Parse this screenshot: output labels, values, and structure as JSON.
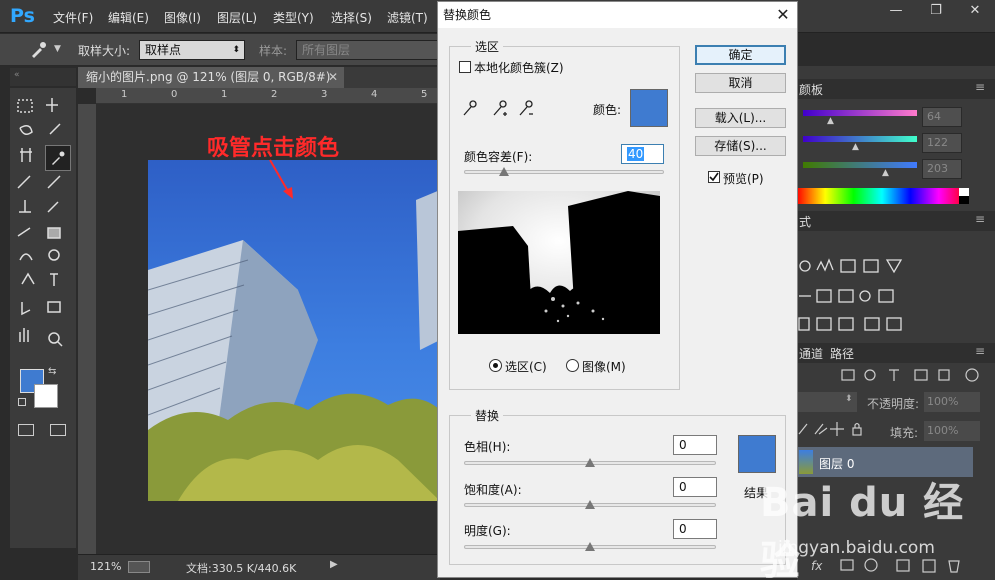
{
  "app": {
    "logo": "Ps",
    "menus": [
      "文件(F)",
      "编辑(E)",
      "图像(I)",
      "图层(L)",
      "类型(Y)",
      "选择(S)",
      "滤镜(T)"
    ]
  },
  "options": {
    "sample_size_label": "取样大小:",
    "sample_size_value": "取样点",
    "sample_label": "样本:",
    "sample_value": "所有图层"
  },
  "document": {
    "tab_title": "缩小的图片.png @ 121% (图层 0, RGB/8#)",
    "ruler_marks": [
      "1",
      "0",
      "1",
      "2",
      "3",
      "4",
      "5"
    ],
    "annotation": "吸管点击颜色",
    "zoom": "121%",
    "doc_info": "文档:330.5 K/440.6K"
  },
  "dialog": {
    "title": "替换颜色",
    "selection_group": "选区",
    "localized_label": "本地化颜色簇(Z)",
    "color_label": "颜色:",
    "fuzziness_label": "颜色容差(F):",
    "fuzziness_value": "40",
    "fuzziness_level": 0.2,
    "radio_selection": "选区(C)",
    "radio_image": "图像(M)",
    "ok": "确定",
    "cancel": "取消",
    "load": "载入(L)...",
    "save": "存储(S)...",
    "preview": "预览(P)",
    "replace_group": "替换",
    "hue_label": "色相(H):",
    "hue_value": "0",
    "saturation_label": "饱和度(A):",
    "saturation_value": "0",
    "lightness_label": "明度(G):",
    "lightness_value": "0",
    "result_label": "结果",
    "swatch_color": "#3f7bd0"
  },
  "panels": {
    "color_tab": "颜板",
    "r_value": "64",
    "g_value": "122",
    "b_value": "203",
    "styles_tab": "式",
    "channels_tab": "通道",
    "paths_tab": "路径",
    "opacity_label": "不透明度:",
    "opacity_value": "100%",
    "fill_label": "填充:",
    "fill_value": "100%",
    "layer_name": "图层 0"
  },
  "watermark": {
    "brand": "Bai du 经验",
    "url": "jingyan.baidu.com"
  }
}
